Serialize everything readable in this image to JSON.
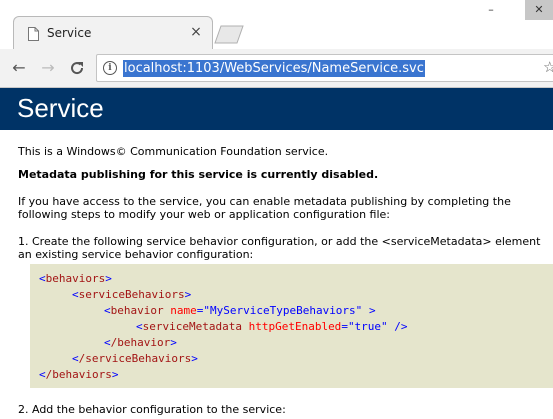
{
  "browser": {
    "tab_title": "Service",
    "tab_close": "×",
    "address": "localhost:1103/WebServices/NameService.svc",
    "back": "←",
    "forward": "→",
    "reload": "C",
    "star": "☆",
    "window_minimize": "–",
    "window_close": "✕"
  },
  "page": {
    "title": "Service",
    "intro": "This is a Windows© Communication Foundation service.",
    "metadata_notice": "Metadata publishing for this service is currently disabled.",
    "access_line1": "If you have access to the service, you can enable metadata publishing by completing the",
    "access_line2": "following steps to modify your web or application configuration file:",
    "step1_line1": "1. Create the following service behavior configuration, or add the <serviceMetadata> element",
    "step1_line2": "an existing service behavior configuration:",
    "step2": "2. Add the behavior configuration to the service:"
  },
  "code": {
    "behaviors_open": "behaviors",
    "service_behaviors_open": "serviceBehaviors",
    "behavior_elem": "behavior",
    "behavior_attr": "name",
    "behavior_val": "\"MyServiceTypeBehaviors\"",
    "metadata_elem": "serviceMetadata",
    "metadata_attr": "httpGetEnabled",
    "metadata_val": "\"true\"",
    "behavior_close": "/behavior",
    "service_behaviors_close": "/serviceBehaviors",
    "behaviors_close": "/behaviors",
    "lt": "<",
    "gt": ">",
    "eq": "=",
    "self_close": " />"
  },
  "colors": {
    "header_bg": "#003366",
    "code_bg": "#e5e5cc",
    "url_highlight": "#3a75d0"
  }
}
